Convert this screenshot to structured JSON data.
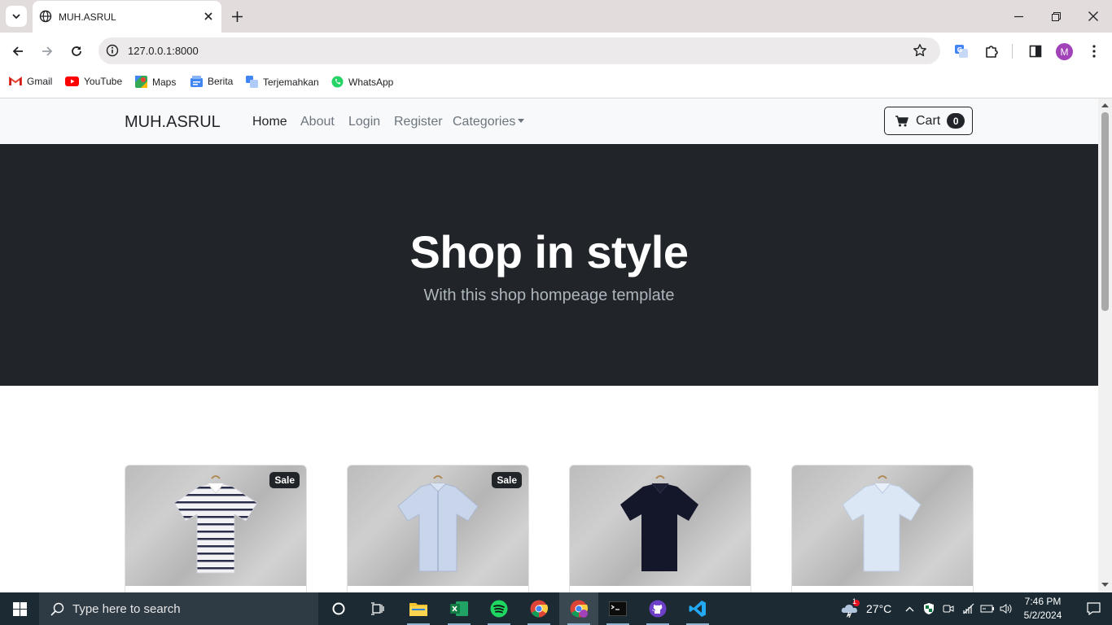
{
  "browser": {
    "tab_title": "MUH.ASRUL",
    "url": "127.0.0.1:8000",
    "profile_initial": "M",
    "bookmarks": [
      {
        "label": "Gmail"
      },
      {
        "label": "YouTube"
      },
      {
        "label": "Maps"
      },
      {
        "label": "Berita"
      },
      {
        "label": "Terjemahkan"
      },
      {
        "label": "WhatsApp"
      }
    ]
  },
  "page": {
    "brand": "MUH.ASRUL",
    "nav": [
      "Home",
      "About",
      "Login",
      "Register",
      "Categories"
    ],
    "active_nav": "Home",
    "cart": {
      "label": "Cart",
      "count": "0"
    },
    "hero": {
      "title": "Shop in style",
      "subtitle": "With this shop hompeage template"
    },
    "products": [
      {
        "badge": "Sale",
        "shirt": "white-navy-striped-polo"
      },
      {
        "badge": "Sale",
        "shirt": "light-blue-button-shirt"
      },
      {
        "badge": "",
        "shirt": "navy-polo"
      },
      {
        "badge": "",
        "shirt": "light-blue-polo"
      }
    ]
  },
  "taskbar": {
    "search_placeholder": "Type here to search",
    "weather": "27°C",
    "weather_badge": "1",
    "time": "7:46 PM",
    "date": "5/2/2024"
  },
  "colors": {
    "navbar_bg": "#f8f9fa",
    "hero_bg": "#212529",
    "taskbar_bg": "#1c2b33",
    "tabstrip_bg": "#e3dcdc"
  }
}
